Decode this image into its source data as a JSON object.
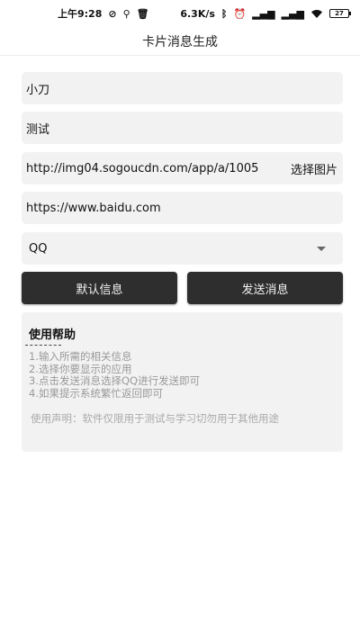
{
  "status_bar": {
    "time": "上午9:28",
    "speed": "6.3K/s",
    "battery": "27"
  },
  "title": "卡片消息生成",
  "form": {
    "title_value": "小刀",
    "desc_value": "测试",
    "image_url_value": "http://img04.sogoucdn.com/app/a/1005",
    "pick_image_label": "选择图片",
    "link_value": "https://www.baidu.com",
    "app_select_value": "QQ"
  },
  "buttons": {
    "default_label": "默认信息",
    "send_label": "发送消息"
  },
  "help": {
    "title": "使用帮助",
    "lines": [
      "1.输入所需的相关信息",
      "2.选择你要显示的应用",
      "3.点击发送消息选择QQ进行发送即可",
      "4.如果提示系统繁忙返回即可"
    ],
    "disclaimer": "使用声明：软件仅限用于测试与学习切勿用于其他用途"
  }
}
